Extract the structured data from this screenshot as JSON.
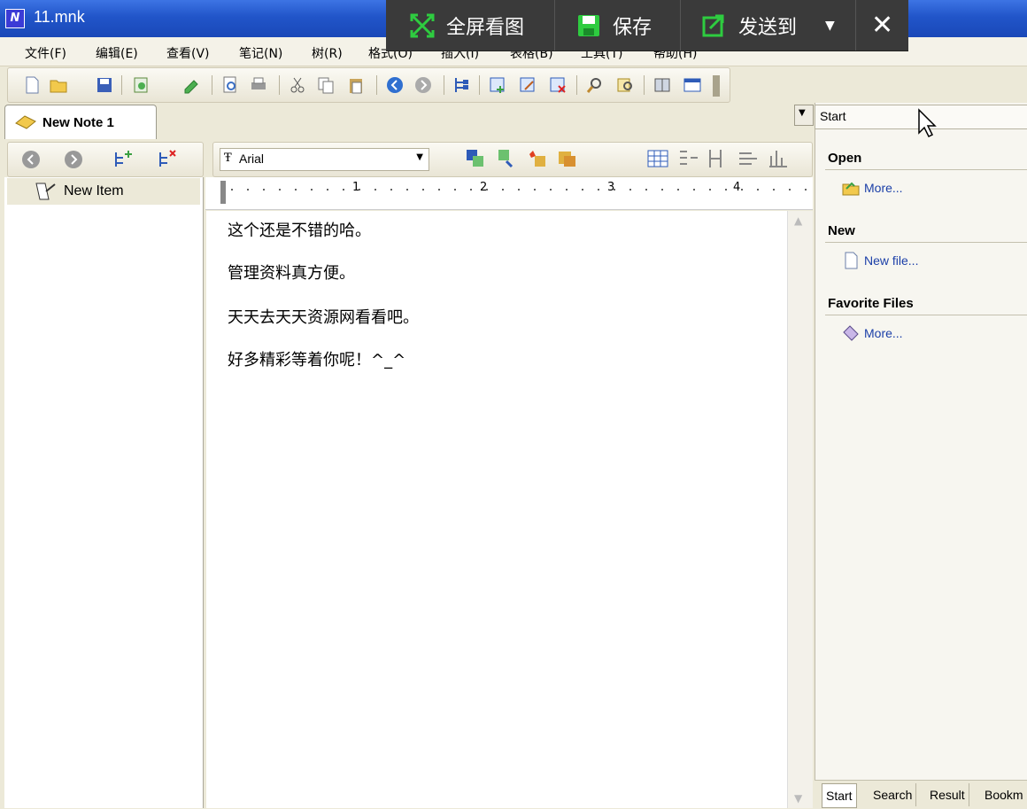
{
  "window": {
    "title": "11.mnk",
    "icon": "mindnote-app-icon"
  },
  "overlay": {
    "fullscreen_label": "全屏看图",
    "save_label": "保存",
    "send_label": "发送到",
    "accent": "#2ecc40"
  },
  "menu": {
    "items": [
      "文件(F)",
      "编辑(E)",
      "查看(V)",
      "笔记(N)",
      "树(R)",
      "格式(O)",
      "插入(I)",
      "表格(B)",
      "工具(T)",
      "帮助(H)"
    ]
  },
  "tab": {
    "label": "New Note 1"
  },
  "tree": {
    "item_label": "New Item"
  },
  "format": {
    "font": "Arial"
  },
  "ruler": {
    "marks": [
      "1",
      "2",
      "3",
      "4"
    ]
  },
  "editor": {
    "lines": [
      "这个还是不错的哈。",
      "管理资料真方便。",
      "天天去天天资源网看看吧。",
      "好多精彩等着你呢！^_^"
    ]
  },
  "task_pane": {
    "selected": "Start",
    "sections": [
      {
        "title": "Open",
        "link": "More...",
        "icon": "folder-open-icon"
      },
      {
        "title": "New",
        "link": "New file...",
        "icon": "new-file-icon"
      },
      {
        "title": "Favorite Files",
        "link": "More...",
        "icon": "favorites-icon"
      }
    ],
    "tabs": [
      "Start",
      "Search",
      "Result",
      "Bookm"
    ]
  }
}
